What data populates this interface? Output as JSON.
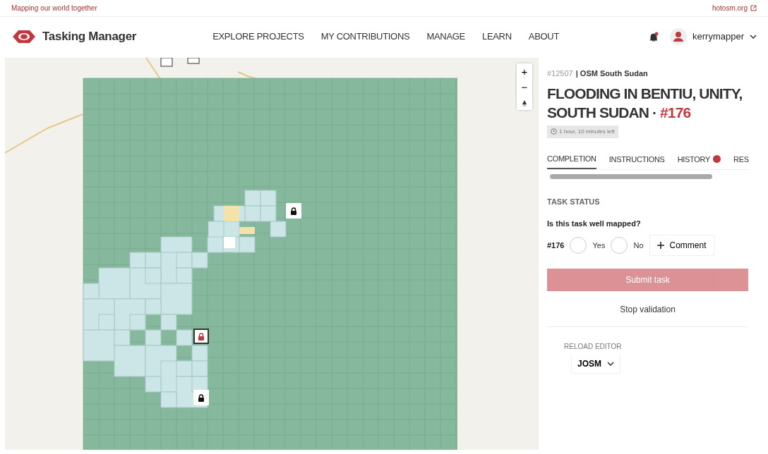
{
  "top_bar": {
    "tagline": "Mapping our world together",
    "link": "hotosm.org"
  },
  "navbar": {
    "brand": "Tasking Manager",
    "links": [
      "EXPLORE PROJECTS",
      "MY CONTRIBUTIONS",
      "MANAGE",
      "LEARN",
      "ABOUT"
    ],
    "user": "kerrymapper"
  },
  "map": {
    "zoom_controls": [
      "+",
      "−"
    ]
  },
  "task_panel": {
    "project_id": "#12507",
    "organisation": "| OSM South Sudan",
    "title": "FLOODING IN BENTIU, UNITY, SOUTH SUDAN · ",
    "task_number": "#176",
    "time_left": "1 hour, 10 minutes left",
    "tabs": [
      {
        "label": "COMPLETION",
        "selected": true,
        "badge": false
      },
      {
        "label": "INSTRUCTIONS",
        "selected": false,
        "badge": false
      },
      {
        "label": "HISTORY",
        "selected": false,
        "badge": true
      },
      {
        "label": "RES",
        "selected": false,
        "badge": false
      }
    ],
    "section_title": "TASK STATUS",
    "question": "Is this task well mapped?",
    "task_ref": "#176",
    "options": [
      {
        "label": "Yes",
        "selected": false
      },
      {
        "label": "No",
        "selected": false
      }
    ],
    "comment_button": "Comment",
    "submit_button": {
      "label": "Submit task",
      "disabled": true
    },
    "stop_button": "Stop validation",
    "reload_label": "RELOAD EDITOR",
    "editor": "JOSM"
  }
}
